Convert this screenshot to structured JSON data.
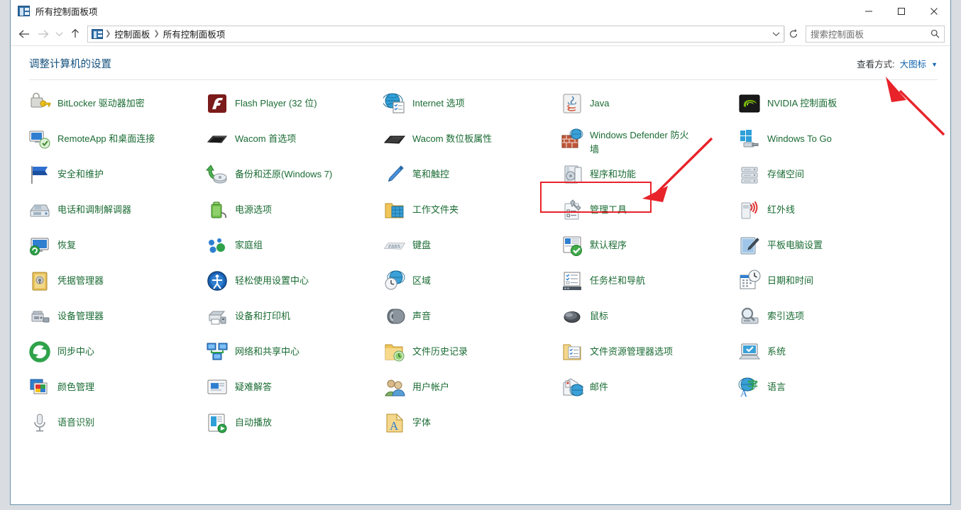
{
  "window": {
    "title": "所有控制面板项",
    "app_icon": "control-panel-icon",
    "controls": {
      "minimize": "–",
      "maximize": "□",
      "close": "✕"
    }
  },
  "toolbar": {
    "back": "back-arrow",
    "forward": "forward-arrow",
    "recent": "chevron-down-icon",
    "up": "up-arrow",
    "breadcrumb": [
      "控制面板",
      "所有控制面板项"
    ],
    "address_dropdown": "chevron-down-icon",
    "refresh": "refresh-icon",
    "search_placeholder": "搜索控制面板",
    "search_value": ""
  },
  "header": {
    "page_title": "调整计算机的设置",
    "view_label": "查看方式:",
    "view_value": "大图标"
  },
  "colors": {
    "accent_blue": "#1667b1",
    "title_blue": "#14507d",
    "item_green": "#1a6b33",
    "annotation_red": "#e8232a"
  },
  "columns": [
    {
      "items": [
        {
          "label": "BitLocker 驱动器加密",
          "icon": "bitlocker-icon"
        },
        {
          "label": "RemoteApp 和桌面连接",
          "icon": "remoteapp-icon"
        },
        {
          "label": "安全和维护",
          "icon": "flag-icon"
        },
        {
          "label": "电话和调制解调器",
          "icon": "modem-icon"
        },
        {
          "label": "恢复",
          "icon": "recovery-icon"
        },
        {
          "label": "凭据管理器",
          "icon": "credential-manager-icon"
        },
        {
          "label": "设备管理器",
          "icon": "device-manager-icon"
        },
        {
          "label": "同步中心",
          "icon": "sync-center-icon"
        },
        {
          "label": "颜色管理",
          "icon": "color-management-icon"
        },
        {
          "label": "语音识别",
          "icon": "microphone-icon"
        }
      ]
    },
    {
      "items": [
        {
          "label": "Flash Player (32 位)",
          "icon": "flash-player-icon"
        },
        {
          "label": "Wacom 首选项",
          "icon": "wacom-tablet-icon"
        },
        {
          "label": "备份和还原(Windows 7)",
          "icon": "backup-restore-icon"
        },
        {
          "label": "电源选项",
          "icon": "power-options-icon"
        },
        {
          "label": "家庭组",
          "icon": "homegroup-icon"
        },
        {
          "label": "轻松使用设置中心",
          "icon": "ease-of-access-icon"
        },
        {
          "label": "设备和打印机",
          "icon": "devices-printers-icon"
        },
        {
          "label": "网络和共享中心",
          "icon": "network-sharing-icon"
        },
        {
          "label": "疑难解答",
          "icon": "troubleshooting-icon"
        },
        {
          "label": "自动播放",
          "icon": "autoplay-icon"
        }
      ]
    },
    {
      "items": [
        {
          "label": "Internet 选项",
          "icon": "internet-options-icon"
        },
        {
          "label": "Wacom 数位板属性",
          "icon": "wacom-properties-icon"
        },
        {
          "label": "笔和触控",
          "icon": "pen-touch-icon"
        },
        {
          "label": "工作文件夹",
          "icon": "work-folders-icon"
        },
        {
          "label": "键盘",
          "icon": "keyboard-icon"
        },
        {
          "label": "区域",
          "icon": "region-icon"
        },
        {
          "label": "声音",
          "icon": "sound-icon"
        },
        {
          "label": "文件历史记录",
          "icon": "file-history-icon"
        },
        {
          "label": "用户帐户",
          "icon": "user-accounts-icon"
        },
        {
          "label": "字体",
          "icon": "fonts-icon"
        }
      ]
    },
    {
      "items": [
        {
          "label": "Java",
          "icon": "java-icon"
        },
        {
          "label": "Windows Defender 防火\n墙",
          "icon": "firewall-icon",
          "two_line": true
        },
        {
          "label": "程序和功能",
          "icon": "programs-features-icon",
          "highlighted": true
        },
        {
          "label": "管理工具",
          "icon": "admin-tools-icon"
        },
        {
          "label": "默认程序",
          "icon": "default-programs-icon"
        },
        {
          "label": "任务栏和导航",
          "icon": "taskbar-navigation-icon"
        },
        {
          "label": "鼠标",
          "icon": "mouse-icon"
        },
        {
          "label": "文件资源管理器选项",
          "icon": "folder-options-icon"
        },
        {
          "label": "邮件",
          "icon": "mail-icon"
        }
      ]
    },
    {
      "items": [
        {
          "label": "NVIDIA 控制面板",
          "icon": "nvidia-icon"
        },
        {
          "label": "Windows To Go",
          "icon": "windows-to-go-icon"
        },
        {
          "label": "存储空间",
          "icon": "storage-spaces-icon"
        },
        {
          "label": "红外线",
          "icon": "infrared-icon"
        },
        {
          "label": "平板电脑设置",
          "icon": "tablet-pc-icon"
        },
        {
          "label": "日期和时间",
          "icon": "date-time-icon"
        },
        {
          "label": "索引选项",
          "icon": "indexing-options-icon"
        },
        {
          "label": "系统",
          "icon": "system-icon"
        },
        {
          "label": "语言",
          "icon": "language-icon"
        }
      ]
    }
  ],
  "annotations": {
    "highlight_target": "程序和功能",
    "arrows": [
      {
        "name": "arrow-to-programs-features",
        "points_to": "程序和功能"
      },
      {
        "name": "arrow-to-view-dropdown",
        "points_to": "大图标"
      }
    ]
  }
}
